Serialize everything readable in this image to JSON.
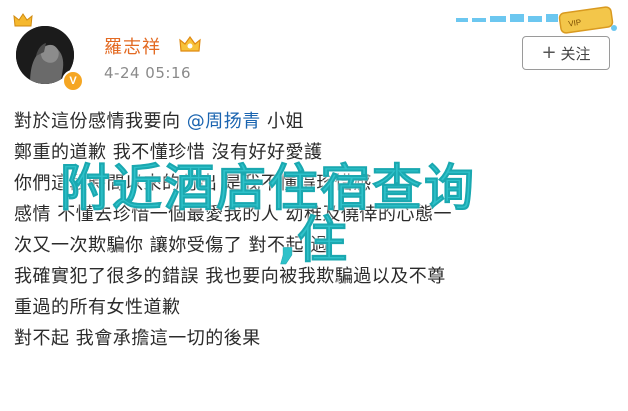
{
  "header": {
    "username": "羅志祥",
    "timestamp": "4-24 05:16",
    "follow_label": "关注",
    "follow_icon": "plus-icon",
    "verified_icon": "verified-v-icon",
    "crown_icon": "crown-icon",
    "vip_icon": "vip-badge-icon"
  },
  "post": {
    "lines": [
      {
        "before": "對於這份感情我要向 ",
        "mention": "@周扬青",
        "after": " 小姐"
      },
      {
        "text": "鄭重的道歉 我不懂珍惜 沒有好好愛護"
      },
      {
        "text": "你們這段時間以來的付出 是我不懂得珍惜感"
      },
      {
        "text": "感情 不懂去珍惜一個最愛我的人 幼稚及僥倖的心態一"
      },
      {
        "text": "次又一次欺騙你 讓妳受傷了 對不起 過"
      },
      {
        "text": "我確實犯了很多的錯誤 我也要向被我欺騙過以及不尊"
      },
      {
        "text": "重過的所有女性道歉"
      },
      {
        "text": "對不起   我會承擔這一切的後果"
      }
    ]
  },
  "overlay": {
    "line1": "附近酒店住宿查询",
    "line2": ",住"
  },
  "colors": {
    "username": "#e36a22",
    "mention": "#1a64b0",
    "overlay": "#2ec1c9",
    "badge": "#f5a623"
  }
}
